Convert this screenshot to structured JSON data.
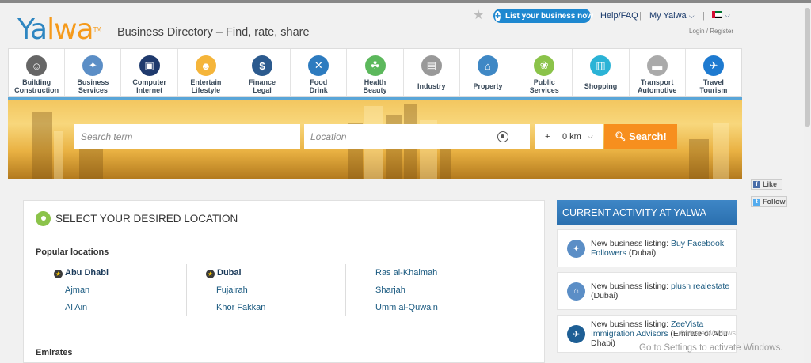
{
  "header": {
    "logo_a": "Ya",
    "logo_b": "lwa",
    "logo_tm": "TM",
    "tagline": "Business Directory – Find, rate, share",
    "list_business": "List your business now",
    "help": "Help/FAQ",
    "my_yalwa": "My Yalwa",
    "login_register": "Login / Register"
  },
  "categories": [
    {
      "line1": "Building",
      "line2": "Construction",
      "color": "#666666",
      "icon": "person-icon"
    },
    {
      "line1": "Business",
      "line2": "Services",
      "color": "#5b8ec6",
      "icon": "handshake-icon"
    },
    {
      "line1": "Computer",
      "line2": "Internet",
      "color": "#1f3a6d",
      "icon": "monitor-icon"
    },
    {
      "line1": "Entertain",
      "line2": "Lifestyle",
      "color": "#f5b53a",
      "icon": "mask-icon"
    },
    {
      "line1": "Finance",
      "line2": "Legal",
      "color": "#2b5a8e",
      "icon": "dollar-icon"
    },
    {
      "line1": "Food",
      "line2": "Drink",
      "color": "#2d7bbf",
      "icon": "cutlery-icon"
    },
    {
      "line1": "Health",
      "line2": "Beauty",
      "color": "#5cb85c",
      "icon": "leaf-icon"
    },
    {
      "line1": "Industry",
      "line2": "",
      "color": "#999999",
      "icon": "factory-icon"
    },
    {
      "line1": "Property",
      "line2": "",
      "color": "#3f88c5",
      "icon": "house-icon"
    },
    {
      "line1": "Public",
      "line2": "Services",
      "color": "#8bc34a",
      "icon": "community-icon"
    },
    {
      "line1": "Shopping",
      "line2": "",
      "color": "#2bb3d6",
      "icon": "cart-icon"
    },
    {
      "line1": "Transport",
      "line2": "Automotive",
      "color": "#aaaaaa",
      "icon": "truck-icon"
    },
    {
      "line1": "Travel",
      "line2": "Tourism",
      "color": "#1e7ad0",
      "icon": "plane-icon"
    }
  ],
  "search": {
    "term_placeholder": "Search term",
    "location_placeholder": "Location",
    "plus": "+",
    "km_value": "0 km",
    "button": "Search!"
  },
  "social": {
    "like": "Like",
    "follow": "Follow"
  },
  "location_panel": {
    "title": "SELECT YOUR DESIRED LOCATION",
    "popular_heading": "Popular locations",
    "col1": [
      "Abu Dhabi",
      "Ajman",
      "Al Ain"
    ],
    "col2": [
      "Dubai",
      "Fujairah",
      "Khor Fakkan"
    ],
    "col3": [
      "Ras al-Khaimah",
      "Sharjah",
      "Umm al-Quwain"
    ],
    "emirates_heading": "Emirates"
  },
  "activity": {
    "title": "CURRENT ACTIVITY AT YALWA",
    "items": [
      {
        "prefix": "New business listing:",
        "link": "Buy Facebook Followers",
        "suffix": "(Dubai)",
        "icon": "handshake-icon"
      },
      {
        "prefix": "New business listing:",
        "link": "plush realestate",
        "suffix": "(Dubai)",
        "icon": "house-icon"
      },
      {
        "prefix": "New business listing:",
        "link": "ZeeVista Immigration Advisors",
        "suffix": "(Emirate of Abu Dhabi)",
        "icon": "plane-icon"
      }
    ]
  },
  "watermark": {
    "title": "Activate Windows",
    "text": "Go to Settings to activate Windows."
  }
}
